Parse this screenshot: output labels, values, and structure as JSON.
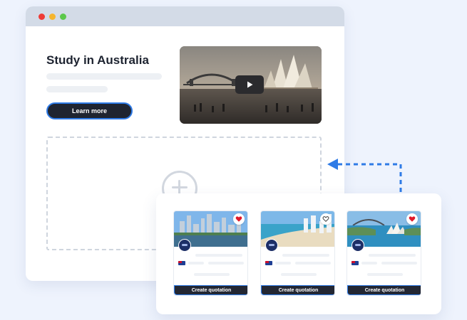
{
  "window": {
    "controls": [
      "close",
      "minimize",
      "maximize"
    ]
  },
  "hero": {
    "title": "Study in Australia",
    "cta_label": "Learn more",
    "video_icon": "play-icon"
  },
  "dropzone": {
    "icon": "plus-circle-icon"
  },
  "cards": [
    {
      "image": "brisbane-skyline",
      "favorite": true,
      "button_label": "Create quotation"
    },
    {
      "image": "gold-coast-beach",
      "favorite": false,
      "button_label": "Create quotation"
    },
    {
      "image": "sydney-harbour",
      "favorite": true,
      "button_label": "Create quotation"
    }
  ],
  "colors": {
    "accent_blue": "#2f7be6",
    "button_dark": "#1f2430",
    "favorite_red": "#e0192b",
    "background": "#eef3fd"
  }
}
